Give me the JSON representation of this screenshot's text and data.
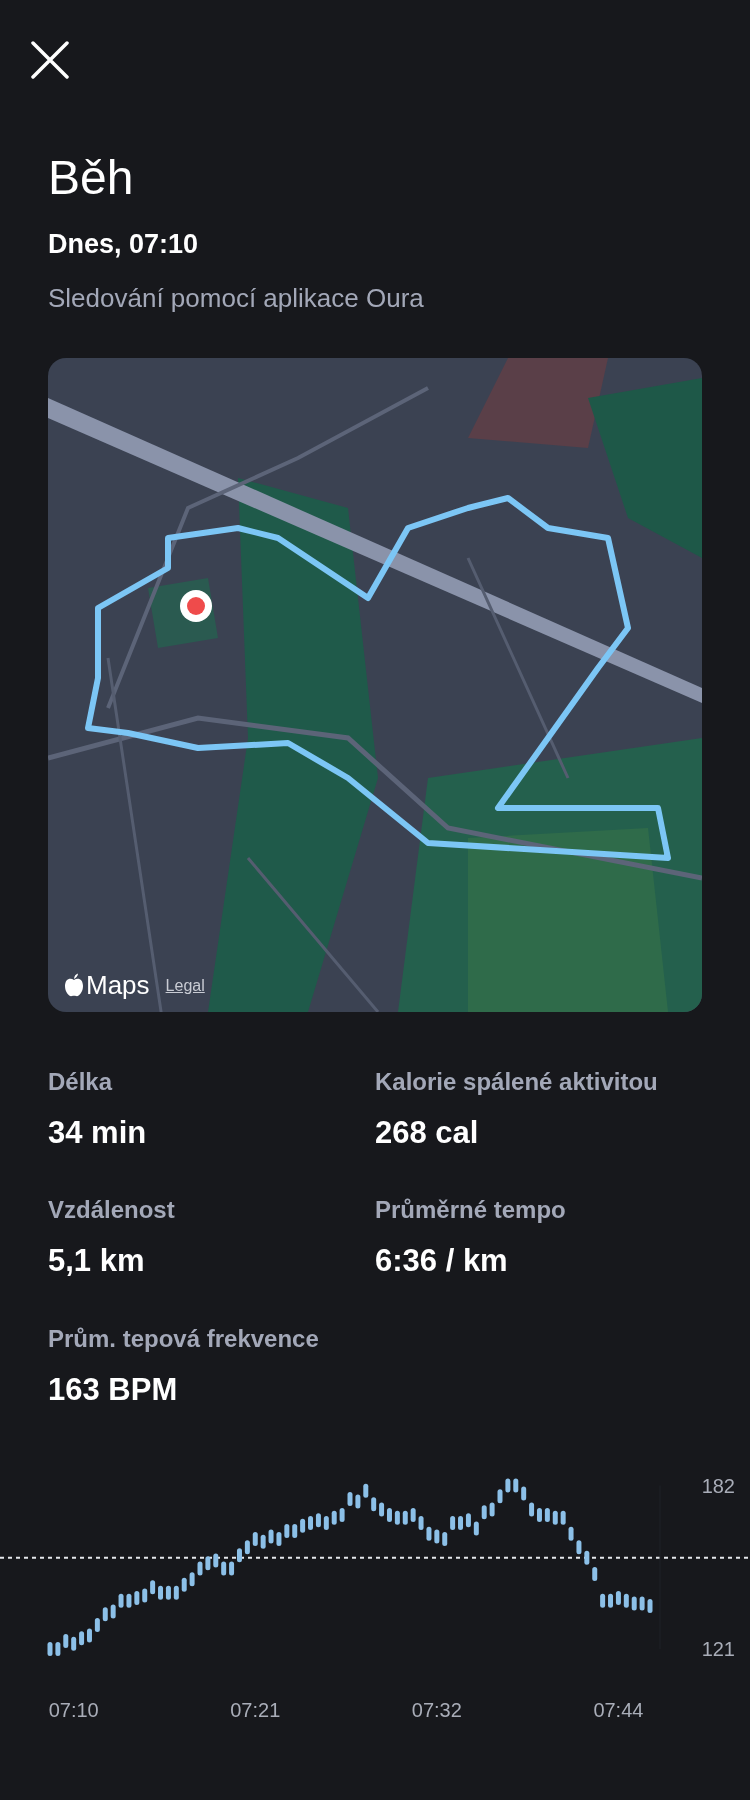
{
  "title": "Běh",
  "date": "Dnes, 07:10",
  "source": "Sledování pomocí aplikace Oura",
  "map": {
    "kind": "picture",
    "brand": "Maps",
    "legal": "Legal"
  },
  "stats": [
    {
      "label": "Délka",
      "value": "34 min"
    },
    {
      "label": "Kalorie spálené aktivitou",
      "value": "268 cal"
    },
    {
      "label": "Vzdálenost",
      "value": "5,1 km"
    },
    {
      "label": "Průměrné tempo",
      "value": "6:36 / km"
    },
    {
      "label": "Prům. tepová frekvence",
      "value": "163 BPM"
    }
  ],
  "chart_data": {
    "type": "scatter",
    "categories": [
      null,
      null,
      null,
      "07:10",
      null,
      null,
      null,
      null,
      null,
      null,
      null,
      null,
      null,
      null,
      null,
      null,
      null,
      null,
      null,
      null,
      null,
      null,
      null,
      null,
      null,
      null,
      "07:21",
      null,
      null,
      null,
      null,
      null,
      null,
      null,
      null,
      null,
      null,
      null,
      null,
      null,
      null,
      null,
      null,
      null,
      null,
      null,
      null,
      null,
      null,
      "07:32",
      null,
      null,
      null,
      null,
      null,
      null,
      null,
      null,
      null,
      null,
      null,
      null,
      null,
      null,
      null,
      null,
      null,
      null,
      null,
      null,
      null,
      null,
      "07:44",
      null,
      null,
      null,
      null
    ],
    "series": [
      {
        "color": "#8cc0e8",
        "values": [
          121,
          121,
          124,
          123,
          125,
          126,
          130,
          134,
          135,
          139,
          139,
          140,
          141,
          144,
          142,
          142,
          142,
          145,
          147,
          151,
          153,
          154,
          151,
          151,
          156,
          159,
          162,
          161,
          163,
          162,
          165,
          165,
          167,
          168,
          169,
          168,
          170,
          171,
          177,
          176,
          180,
          175,
          173,
          171,
          170,
          170,
          171,
          168,
          164,
          163,
          162,
          168,
          168,
          169,
          166,
          172,
          173,
          178,
          182,
          182,
          179,
          173,
          171,
          171,
          170,
          170,
          164,
          159,
          155,
          149,
          139,
          139,
          140,
          139,
          138,
          138,
          137
        ]
      }
    ],
    "ylim": [
      121,
      182
    ],
    "yticks": [
      182,
      121
    ],
    "ref_lines": [
      {
        "axis": "y",
        "value": 155
      }
    ]
  }
}
